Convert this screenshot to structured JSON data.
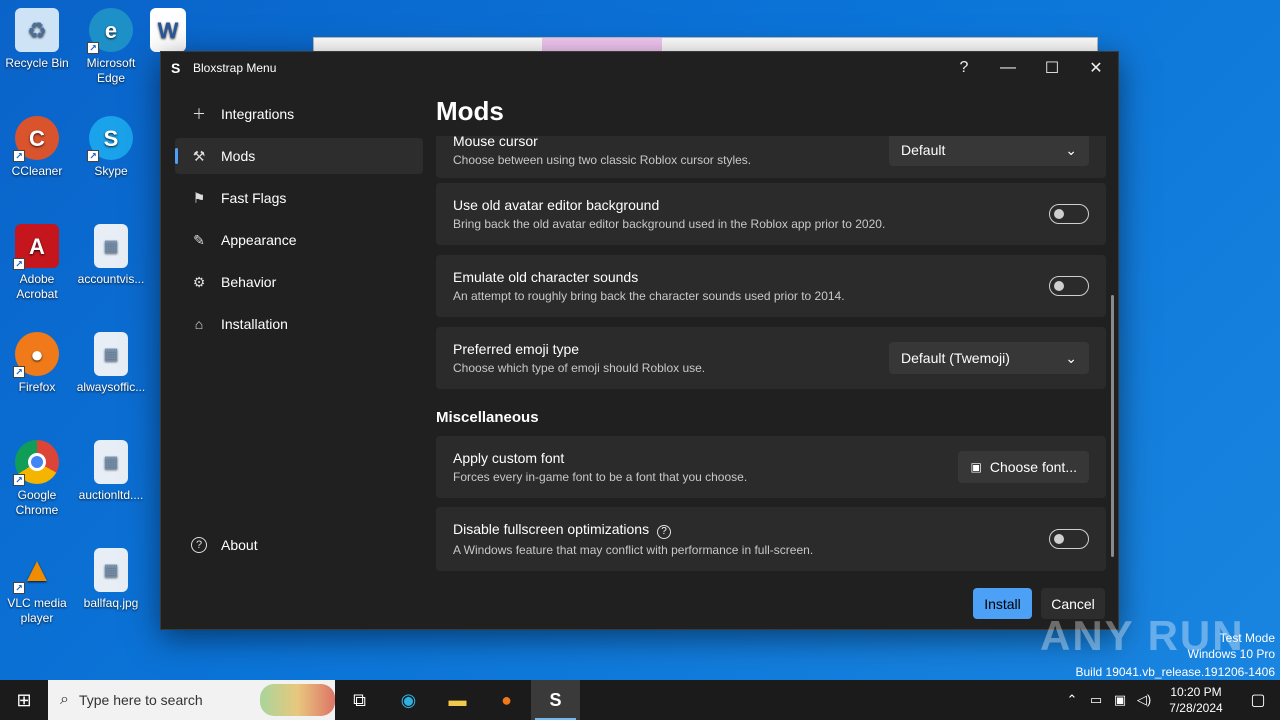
{
  "desktop_icons": [
    {
      "label": "Recycle Bin",
      "color": "#cfe3f7"
    },
    {
      "label": "Microsoft Edge",
      "color": "#1e90c8"
    },
    {
      "label": "CCleaner",
      "color": "#d9532d"
    },
    {
      "label": "Skype",
      "color": "#1aa3ea"
    },
    {
      "label": "Adobe Acrobat",
      "color": "#c4161c"
    },
    {
      "label": "accountvis...",
      "color": "#e8eef5"
    },
    {
      "label": "Firefox",
      "color": "#f07a1a"
    },
    {
      "label": "alwaysoffic...",
      "color": "#e8eef5"
    },
    {
      "label": "Google Chrome",
      "color": "#2f8f4a"
    },
    {
      "label": "auctionltd....",
      "color": "#e8eef5"
    },
    {
      "label": "VLC media player",
      "color": "#f08c00"
    },
    {
      "label": "ballfaq.jpg",
      "color": "#e8eef5"
    }
  ],
  "window": {
    "title": "Bloxstrap Menu",
    "help": "?",
    "minimize": "—",
    "maximize": "☐",
    "close": "✕"
  },
  "sidebar": {
    "items": [
      {
        "label": "Integrations",
        "icon": "＋"
      },
      {
        "label": "Mods",
        "icon": "⚒"
      },
      {
        "label": "Fast Flags",
        "icon": "⚑"
      },
      {
        "label": "Appearance",
        "icon": "✎"
      },
      {
        "label": "Behavior",
        "icon": "⚙"
      },
      {
        "label": "Installation",
        "icon": "⌂"
      }
    ],
    "about": {
      "label": "About",
      "icon": "?"
    }
  },
  "main": {
    "title": "Mods",
    "cards": [
      {
        "title": "Mouse cursor",
        "desc": "Choose between using two classic Roblox cursor styles.",
        "value": "Default"
      },
      {
        "title": "Use old avatar editor background",
        "desc": "Bring back the old avatar editor background used in the Roblox app prior to 2020."
      },
      {
        "title": "Emulate old character sounds",
        "desc": "An attempt to roughly bring back the character sounds used prior to 2014."
      },
      {
        "title": "Preferred emoji type",
        "desc": "Choose which type of emoji should Roblox use.",
        "value": "Default (Twemoji)"
      }
    ],
    "section": "Miscellaneous",
    "misc": [
      {
        "title": "Apply custom font",
        "desc": "Forces every in-game font to be a font that you choose.",
        "button": "Choose font..."
      },
      {
        "title": "Disable fullscreen optimizations",
        "desc": "A Windows feature that may conflict with performance in full-screen."
      }
    ]
  },
  "footer": {
    "install": "Install",
    "cancel": "Cancel"
  },
  "watermark": "ANY RUN",
  "os_info": {
    "line1": "Test Mode",
    "line2": "Windows 10 Pro",
    "line3": "Build 19041.vb_release.191206-1406"
  },
  "taskbar": {
    "search_placeholder": "Type here to search",
    "time": "10:20 PM",
    "date": "7/28/2024"
  },
  "colors": {
    "accent": "#4ca0f5",
    "window_bg": "#202020",
    "card_bg": "#2b2b2b"
  }
}
